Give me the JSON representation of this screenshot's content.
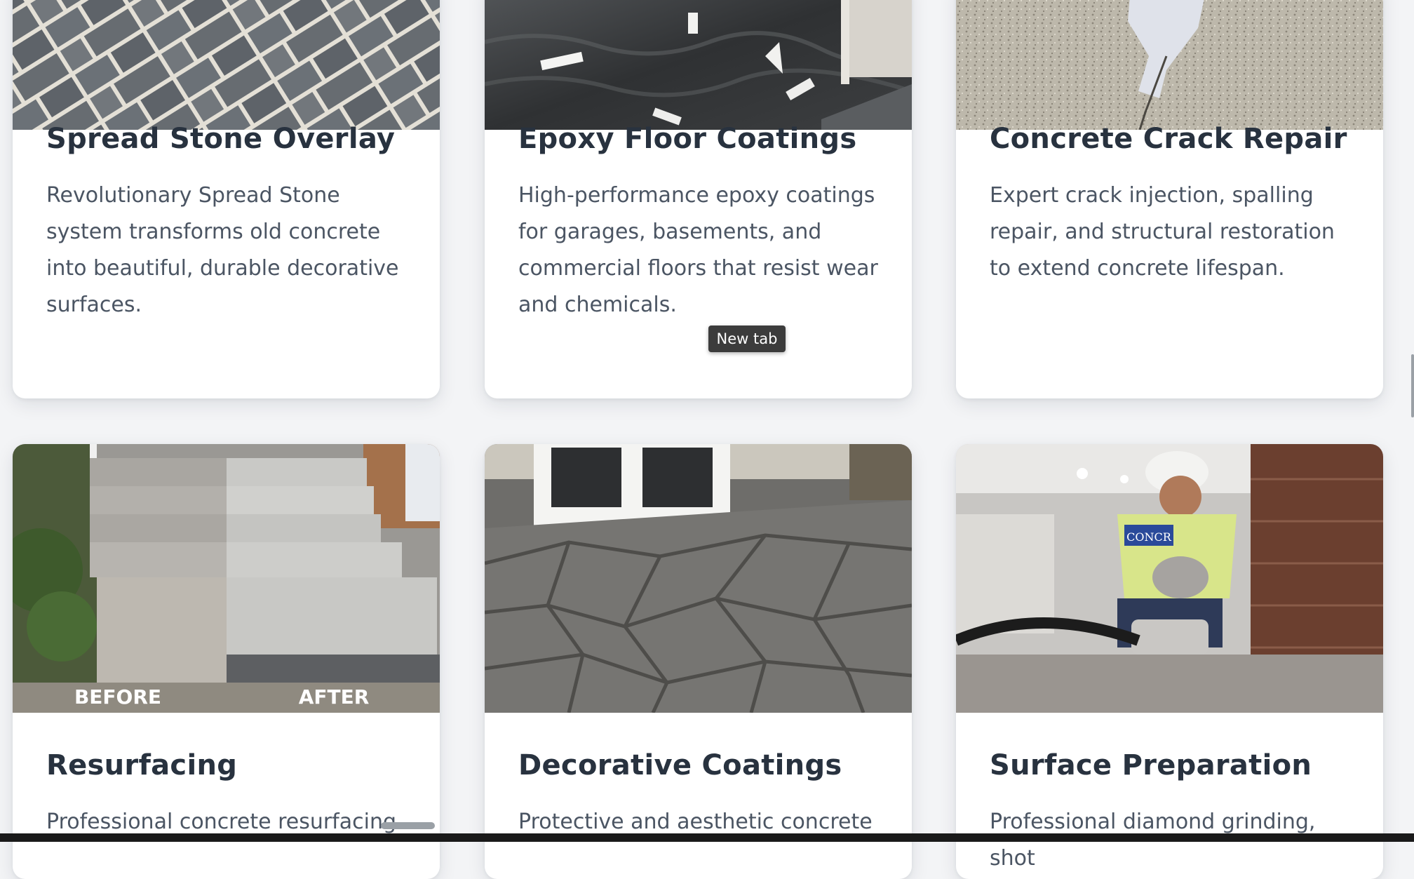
{
  "cards": [
    {
      "title": "Spread Stone Overlay",
      "description": "Revolutionary Spread Stone system transforms old concrete into beautiful, durable decorative surfaces.",
      "image": "gray-stone-paver-pattern"
    },
    {
      "title": "Epoxy Floor Coatings",
      "description": "High-performance epoxy coatings for garages, basements, and commercial floors that resist wear and chemicals.",
      "image": "glossy-dark-epoxy-floor"
    },
    {
      "title": "Concrete Crack Repair",
      "description": "Expert crack injection, spalling repair, and structural restoration to extend concrete lifespan.",
      "image": "speckled-concrete-crack-patch"
    },
    {
      "title": "Resurfacing",
      "description": "Professional concrete resurfacing",
      "image": "before-after-resurfaced-steps",
      "image_labels": {
        "before": "BEFORE",
        "after": "AFTER"
      }
    },
    {
      "title": "Decorative Coatings",
      "description": "Protective and aesthetic concrete",
      "image": "stamped-flagstone-patio"
    },
    {
      "title": "Surface Preparation",
      "description": "Professional diamond grinding, shot",
      "image": "worker-grinding-concrete",
      "image_labels": {
        "shirt": "CONCR"
      }
    }
  ],
  "tooltip": {
    "text": "New tab"
  },
  "colors": {
    "page_bg": "#f3f4f6",
    "card_bg": "#ffffff",
    "title": "#28323f",
    "body_text": "#4b5563"
  }
}
